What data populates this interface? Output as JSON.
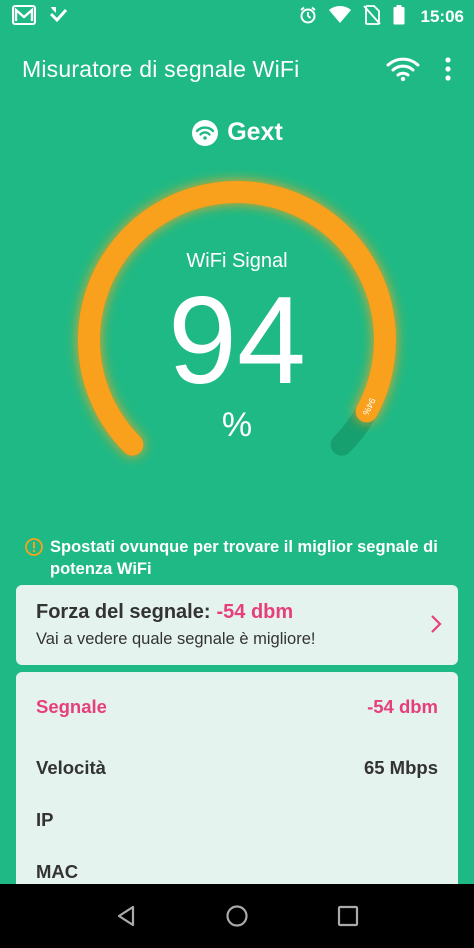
{
  "status_bar": {
    "time": "15:06",
    "icons": [
      "gmail-icon",
      "check-icon",
      "alarm-icon",
      "wifi-icon",
      "no-sim-icon",
      "battery-icon"
    ]
  },
  "app_bar": {
    "title": "Misuratore di segnale WiFi",
    "actions": [
      "wifi-icon",
      "more-vert-icon"
    ]
  },
  "network": {
    "icon": "wifi-circle-icon",
    "ssid": "Gext"
  },
  "gauge": {
    "label": "WiFi Signal",
    "value": "94",
    "unit": "%",
    "marker_label": "94%",
    "level_fraction": 0.94
  },
  "tip": {
    "icon": "info-icon",
    "text": "Spostati ovunque per trovare il miglior segnale di potenza WiFi"
  },
  "strength_card": {
    "label": "Forza del segnale:",
    "value": "-54 dbm",
    "subtitle": "Vai a vedere quale segnale è migliore!"
  },
  "details": [
    {
      "label": "Segnale",
      "value": "-54 dbm",
      "highlight": true
    },
    {
      "label": "Velocità",
      "value": "65 Mbps",
      "highlight": false
    },
    {
      "label": "IP",
      "value": "",
      "highlight": false
    },
    {
      "label": "MAC",
      "value": "",
      "highlight": false
    }
  ],
  "colors": {
    "background": "#1fb985",
    "gauge_arc": "#f9a11b",
    "gauge_track": "#16a06f",
    "accent_pink": "#e63f7b",
    "card_bg": "#e4f3ee"
  }
}
